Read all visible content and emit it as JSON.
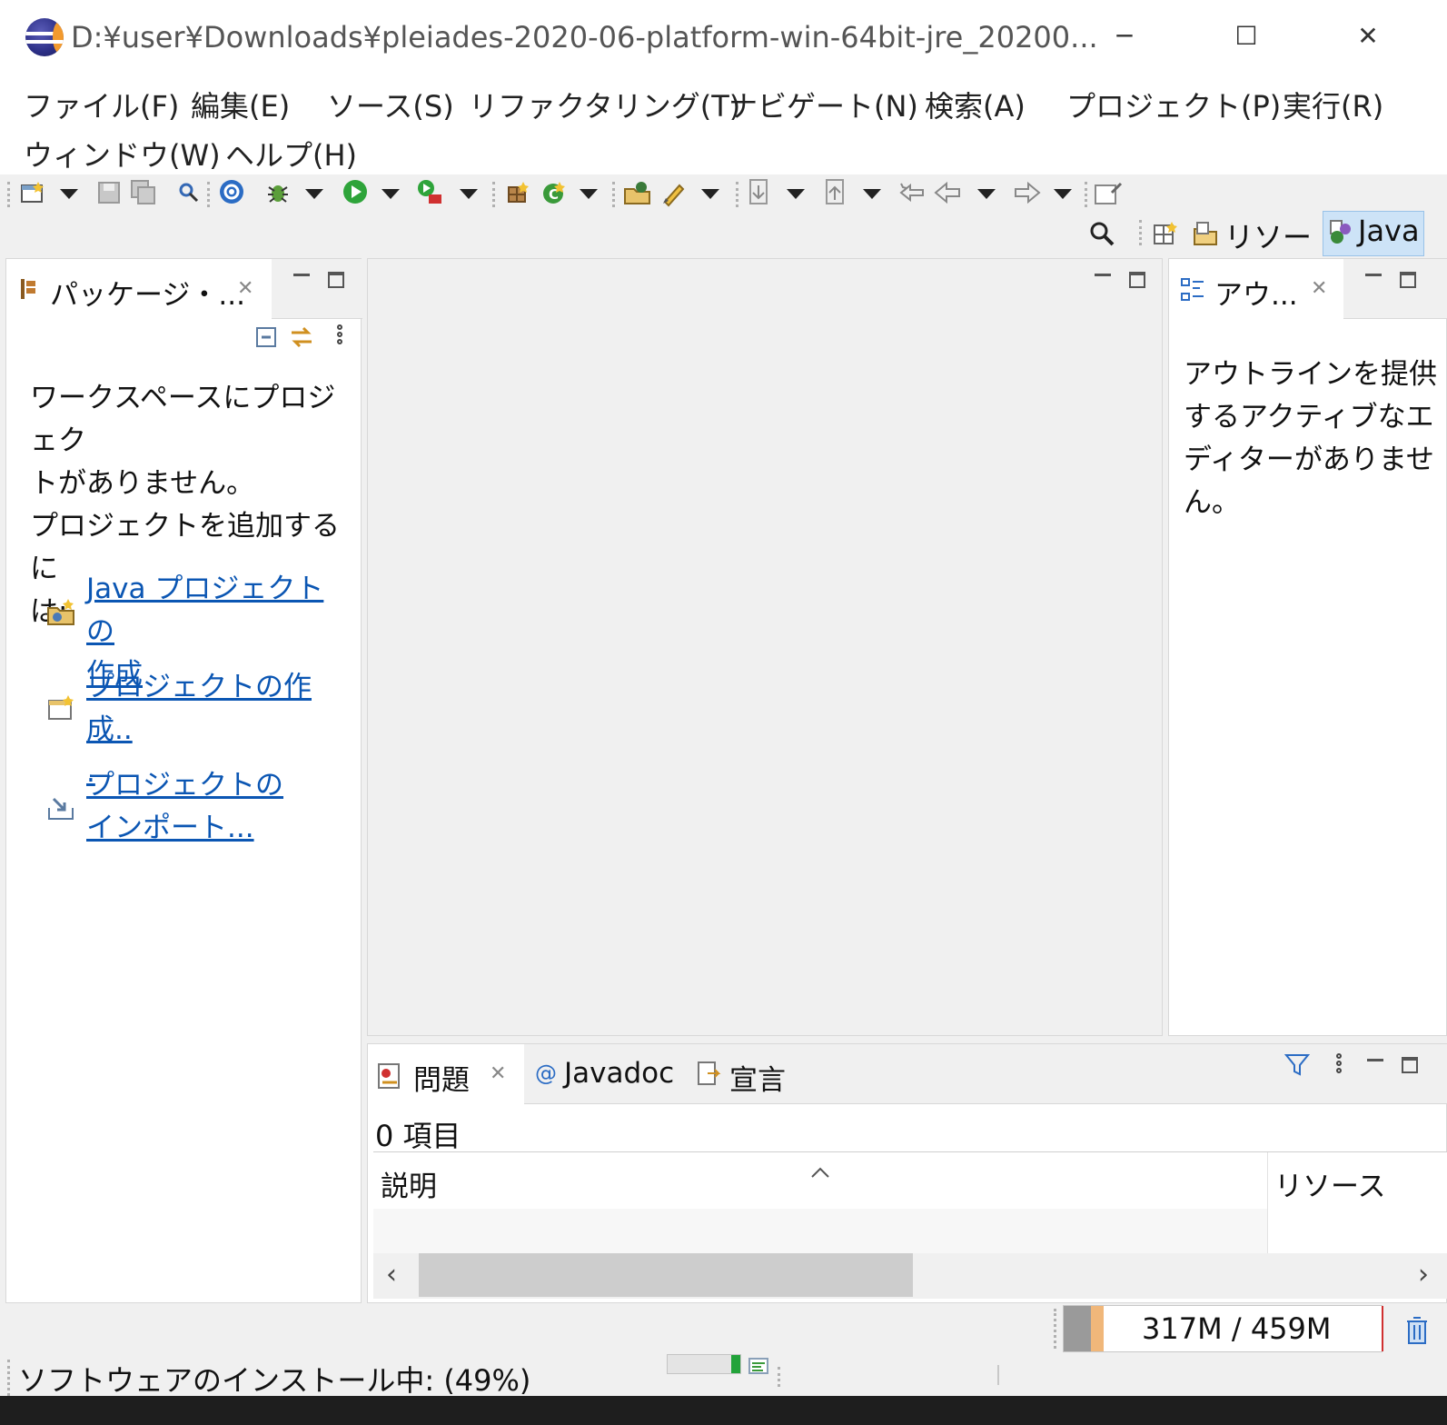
{
  "window": {
    "title": "D:¥user¥Downloads¥pleiades-2020-06-platform-win-64bit-jre_20200...",
    "minimize_glyph": "─",
    "maximize_glyph": "☐",
    "close_glyph": "✕"
  },
  "menu": {
    "items": [
      "ファイル(F)",
      "編集(E)",
      "ソース(S)",
      "リファクタリング(T)",
      "ナビゲート(N)",
      "検索(A)",
      "プロジェクト(P)",
      "実行(R)",
      "ウィンドウ(W)",
      "ヘルプ(H)"
    ]
  },
  "perspectives": {
    "resource": "リソース",
    "java": "Java"
  },
  "package_explorer": {
    "tab_label": "パッケージ・...",
    "message_line1": "ワークスペースにプロジェク",
    "message_line2": "トがありません。",
    "message_line3": "プロジェクトを追加するに",
    "message_line4": "は:",
    "link_java_line1": "Java プロジェクトの",
    "link_java_line2": "作成",
    "link_create_line1": "プロジェクトの作成..",
    "link_create_line2": ".",
    "link_import_line1": "プロジェクトの",
    "link_import_line2": "インポート..."
  },
  "outline": {
    "tab_label": "アウ...",
    "message_line1": "アウトラインを提供",
    "message_line2": "するアクティブなエ",
    "message_line3": "ディターがありませ",
    "message_line4": "ん。"
  },
  "bottom_panel": {
    "tabs": [
      "問題",
      "Javadoc",
      "宣言"
    ],
    "item_count": "0 項目",
    "columns": [
      "説明",
      "リソース"
    ]
  },
  "status": {
    "heap": "317M / 459M",
    "install_progress": "ソフトウェアのインストール中: (49%)",
    "install_fraction": 0.49
  },
  "colors": {
    "link": "#0b56b3",
    "perspective_active_bg": "#cde3f7",
    "heap_used": "#f0b77a",
    "progress_green": "#22a33a"
  }
}
